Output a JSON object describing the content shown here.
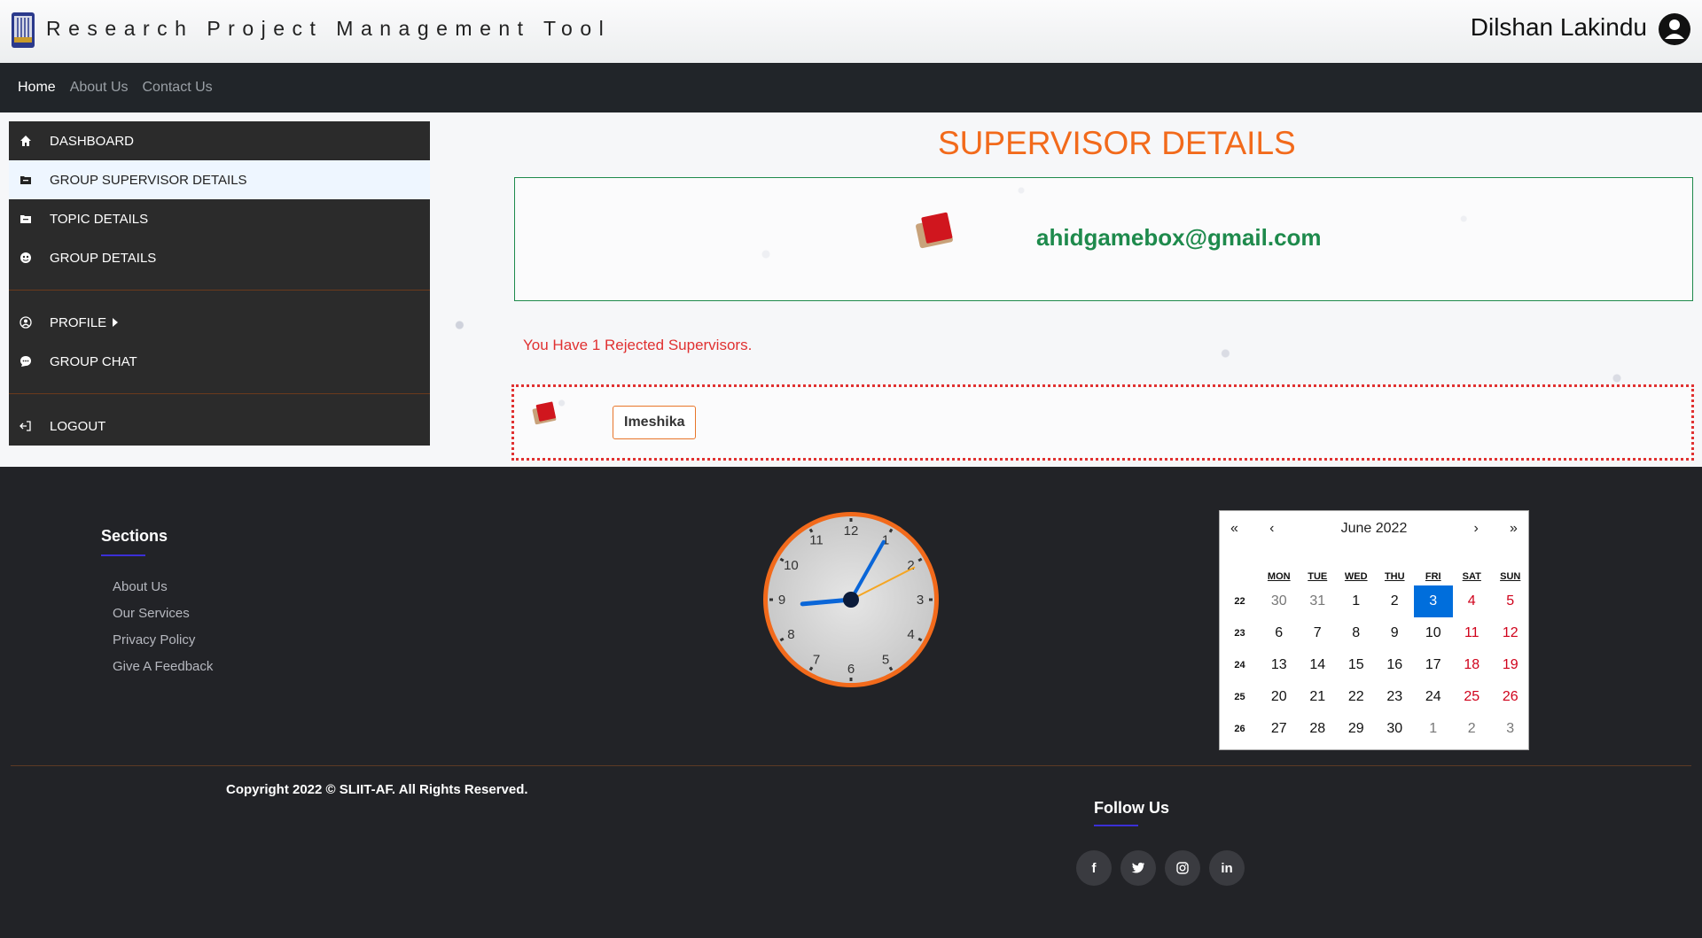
{
  "header": {
    "app_title": "Research Project Management Tool",
    "user_name": "Dilshan Lakindu"
  },
  "navbar": {
    "links": [
      "Home",
      "About Us",
      "Contact Us"
    ]
  },
  "sidebar": {
    "items": [
      {
        "label": "DASHBOARD",
        "icon": "home-icon"
      },
      {
        "label": "GROUP SUPERVISOR DETAILS",
        "icon": "folder-icon"
      },
      {
        "label": "TOPIC DETAILS",
        "icon": "folder-icon"
      },
      {
        "label": "GROUP DETAILS",
        "icon": "group-icon"
      },
      {
        "label": "PROFILE",
        "icon": "user-circle-icon"
      },
      {
        "label": "GROUP CHAT",
        "icon": "chat-icon"
      },
      {
        "label": "LOGOUT",
        "icon": "logout-icon"
      }
    ]
  },
  "main": {
    "title": "SUPERVISOR DETAILS",
    "supervisor_email": "ahidgamebox@gmail.com",
    "rejected_text": "You Have 1 Rejected Supervisors.",
    "rejected_name": "Imeshika"
  },
  "footer": {
    "sections_title": "Sections",
    "links": [
      "About Us",
      "Our Services",
      "Privacy Policy",
      "Give A Feedback"
    ],
    "clock": {
      "numbers": [
        "12",
        "1",
        "2",
        "3",
        "4",
        "5",
        "6",
        "7",
        "8",
        "9",
        "10",
        "11"
      ],
      "hour": 8.83,
      "minute": 4.9,
      "second": 10.5
    },
    "calendar": {
      "title": "June 2022",
      "nav": [
        "«",
        "‹",
        "›",
        "»"
      ],
      "weekdays": [
        "MON",
        "TUE",
        "WED",
        "THU",
        "FRI",
        "SAT",
        "SUN"
      ],
      "weeks": [
        {
          "wk": "22",
          "days": [
            "30",
            "31",
            "1",
            "2",
            "3",
            "4",
            "5"
          ]
        },
        {
          "wk": "23",
          "days": [
            "6",
            "7",
            "8",
            "9",
            "10",
            "11",
            "12"
          ]
        },
        {
          "wk": "24",
          "days": [
            "13",
            "14",
            "15",
            "16",
            "17",
            "18",
            "19"
          ]
        },
        {
          "wk": "25",
          "days": [
            "20",
            "21",
            "22",
            "23",
            "24",
            "25",
            "26"
          ]
        },
        {
          "wk": "26",
          "days": [
            "27",
            "28",
            "29",
            "30",
            "1",
            "2",
            "3"
          ]
        }
      ],
      "selected": "3"
    },
    "copyright": "Copyright 2022 © SLIIT-AF. All Rights Reserved.",
    "follow_title": "Follow Us",
    "socials": [
      {
        "label": "f",
        "icon": "facebook-icon"
      },
      {
        "label": "t",
        "icon": "twitter-icon"
      },
      {
        "label": "ig",
        "icon": "instagram-icon"
      },
      {
        "label": "in",
        "icon": "linkedin-icon"
      }
    ],
    "colors": {
      "accent_orange": "#f26a1b",
      "green": "#1e8a4c",
      "red": "#e03131",
      "blue": "#006edc"
    }
  }
}
